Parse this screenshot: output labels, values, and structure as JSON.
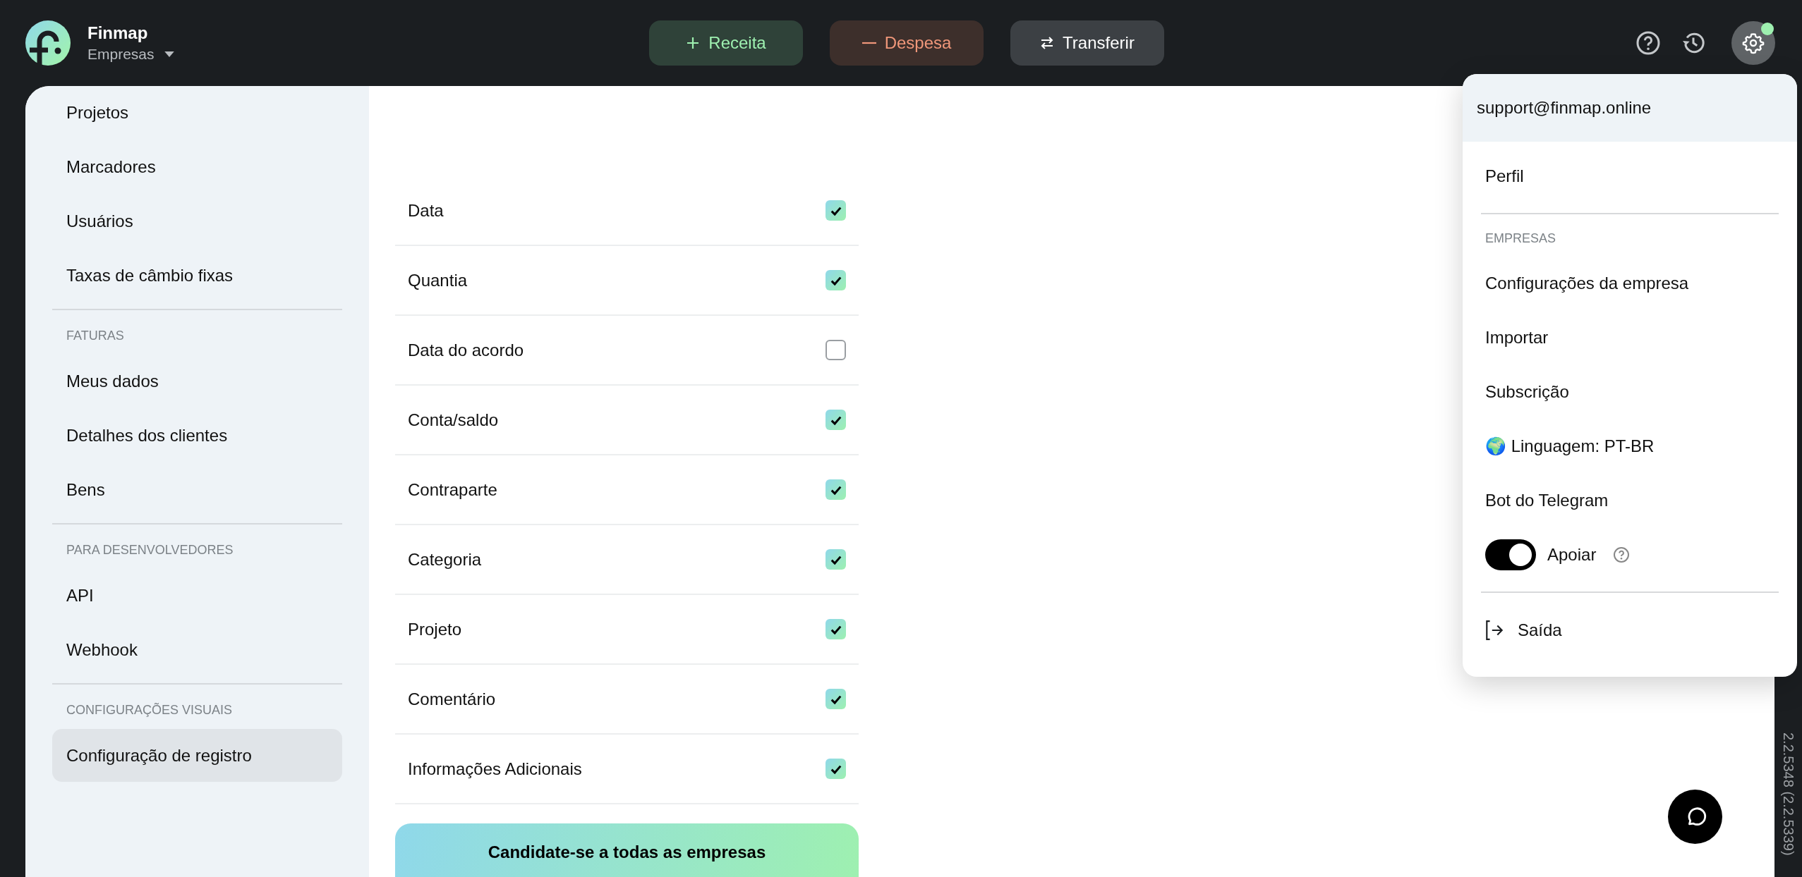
{
  "brand": {
    "name": "Finmap",
    "workspace": "Empresas"
  },
  "actions": [
    {
      "kind": "income",
      "label": "Receita"
    },
    {
      "kind": "expense",
      "label": "Despesa"
    },
    {
      "kind": "transfer",
      "label": "Transferir"
    }
  ],
  "settings_button": {
    "selected": true,
    "badge": true
  },
  "sidebar": {
    "sections": [
      {
        "items": [
          {
            "label": "Projetos",
            "selected": false
          },
          {
            "label": "Marcadores",
            "selected": false
          },
          {
            "label": "Usuários",
            "selected": false
          },
          {
            "label": "Taxas de câmbio fixas",
            "selected": false
          }
        ]
      },
      {
        "heading": "FATURAS",
        "items": [
          {
            "label": "Meus dados",
            "selected": false
          },
          {
            "label": "Detalhes dos clientes",
            "selected": false
          },
          {
            "label": "Bens",
            "selected": false
          }
        ]
      },
      {
        "heading": "PARA DESENVOLVEDORES",
        "items": [
          {
            "label": "API",
            "selected": false
          },
          {
            "label": "Webhook",
            "selected": false
          }
        ]
      },
      {
        "heading": "CONFIGURAÇÕES VISUAIS",
        "items": [
          {
            "label": "Configuração de registro",
            "selected": true
          }
        ]
      }
    ]
  },
  "fields": [
    {
      "label": "Data",
      "checked": true
    },
    {
      "label": "Quantia",
      "checked": true
    },
    {
      "label": "Data do acordo",
      "checked": false
    },
    {
      "label": "Conta/saldo",
      "checked": true
    },
    {
      "label": "Contraparte",
      "checked": true
    },
    {
      "label": "Categoria",
      "checked": true
    },
    {
      "label": "Projeto",
      "checked": true
    },
    {
      "label": "Comentário",
      "checked": true
    },
    {
      "label": "Informações Adicionais",
      "checked": true
    }
  ],
  "apply_button": "Candidate-se a todas as empresas",
  "menu": {
    "email": "support@finmap.online",
    "items": [
      {
        "kind": "item",
        "label": "Perfil"
      },
      {
        "kind": "divider"
      },
      {
        "kind": "heading",
        "label": "EMPRESAS"
      },
      {
        "kind": "item",
        "label": "Configurações da empresa"
      },
      {
        "kind": "item",
        "label": "Importar"
      },
      {
        "kind": "item",
        "label": "Subscrição"
      },
      {
        "kind": "item",
        "label": "🌍 Linguagem: PT-BR"
      },
      {
        "kind": "item",
        "label": "Bot do Telegram"
      },
      {
        "kind": "toggle",
        "label": "Apoiar",
        "on": true
      },
      {
        "kind": "divider"
      },
      {
        "kind": "logout",
        "label": "Saída"
      }
    ]
  },
  "version": "2.2.5348 (2.2.5339)"
}
